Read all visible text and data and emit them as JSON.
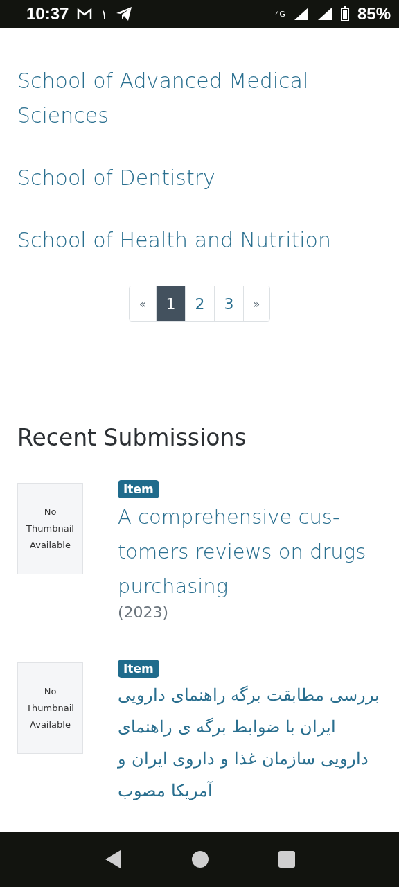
{
  "status_bar": {
    "time": "10:37",
    "notification_mark": "١",
    "network": "4G",
    "battery": "85%"
  },
  "communities": [
    "School of Advanced Medical Sciences",
    "School of Dentistry",
    "School of Health and Nutrition"
  ],
  "pagination": [
    {
      "label": "«",
      "kind": "prev",
      "selected": false
    },
    {
      "label": "1",
      "kind": "page",
      "selected": true
    },
    {
      "label": "2",
      "kind": "page",
      "selected": false
    },
    {
      "label": "3",
      "kind": "page",
      "selected": false
    },
    {
      "label": "»",
      "kind": "next",
      "selected": false
    }
  ],
  "recent_submissions": {
    "heading": "Recent Submissions",
    "items": [
      {
        "thumbnail": [
          "No",
          "Thumbnail",
          "Available"
        ],
        "badge": "Item",
        "title": "A comprehensive cus-tomers reviews on drugs purchasing",
        "date": "(2023)"
      },
      {
        "thumbnail": [
          "No",
          "Thumbnail",
          "Available"
        ],
        "badge": "Item",
        "title": "بررسی مطابقت برگه راهنمای دارویی ایران با ضوابط برگه ی راهنمای دارویی سازمان غذا و داروی ایران و آمریکا مصوب"
      }
    ]
  }
}
